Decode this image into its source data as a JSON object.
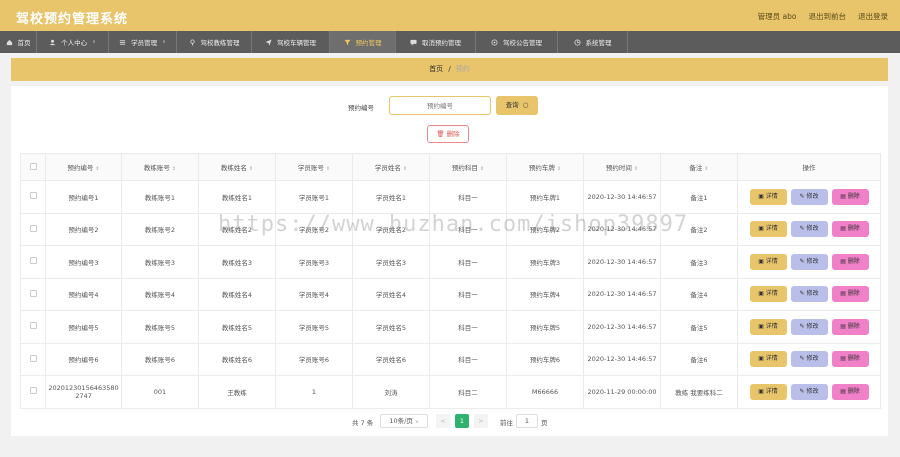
{
  "app": {
    "title": "驾校预约管理系统",
    "admin_label": "管理员 abo",
    "back_label": "退出到前台",
    "logout_label": "退出登录"
  },
  "nav": [
    {
      "label": "首页",
      "icon": "home-icon",
      "caret": false
    },
    {
      "label": "个人中心",
      "icon": "user-icon",
      "caret": true
    },
    {
      "label": "学员管理",
      "icon": "list-icon",
      "caret": true
    },
    {
      "label": "驾校教练管理",
      "icon": "pin-icon",
      "caret": false
    },
    {
      "label": "驾校车辆管理",
      "icon": "send-icon",
      "caret": false
    },
    {
      "label": "预约管理",
      "icon": "filter-icon",
      "caret": false
    },
    {
      "label": "取消预约管理",
      "icon": "chat-icon",
      "caret": false
    },
    {
      "label": "驾校公告管理",
      "icon": "gear-icon",
      "caret": false
    },
    {
      "label": "系统管理",
      "icon": "cog-icon",
      "caret": false
    }
  ],
  "breadcrumb": {
    "home": "首页",
    "separator": "/",
    "current": "预约"
  },
  "search": {
    "label": "预约编号",
    "placeholder": "预约编号",
    "button": "查询"
  },
  "delete_button": "删除",
  "table": {
    "columns": [
      "预约编号",
      "教练账号",
      "教练姓名",
      "学员账号",
      "学员姓名",
      "预约科目",
      "预约车牌",
      "预约时间",
      "备注",
      "操作"
    ],
    "actions": {
      "detail": "详情",
      "edit": "修改",
      "delete": "删除"
    },
    "rows": [
      [
        "预约编号1",
        "教练账号1",
        "教练姓名1",
        "学员账号1",
        "学员姓名1",
        "科目一",
        "预约车牌1",
        "2020-12-30 14:46:57",
        "备注1"
      ],
      [
        "预约编号2",
        "教练账号2",
        "教练姓名2",
        "学员账号2",
        "学员姓名2",
        "科目一",
        "预约车牌2",
        "2020-12-30 14:46:57",
        "备注2"
      ],
      [
        "预约编号3",
        "教练账号3",
        "教练姓名3",
        "学员账号3",
        "学员姓名3",
        "科目一",
        "预约车牌3",
        "2020-12-30 14:46:57",
        "备注3"
      ],
      [
        "预约编号4",
        "教练账号4",
        "教练姓名4",
        "学员账号4",
        "学员姓名4",
        "科目一",
        "预约车牌4",
        "2020-12-30 14:46:57",
        "备注4"
      ],
      [
        "预约编号5",
        "教练账号5",
        "教练姓名5",
        "学员账号5",
        "学员姓名5",
        "科目一",
        "预约车牌5",
        "2020-12-30 14:46:57",
        "备注5"
      ],
      [
        "预约编号6",
        "教练账号6",
        "教练姓名6",
        "学员账号6",
        "学员姓名6",
        "科目一",
        "预约车牌6",
        "2020-12-30 14:46:57",
        "备注6"
      ],
      [
        "20201230156463580 2747",
        "001",
        "王教练",
        "1",
        "刘涛",
        "科目二",
        "M66666",
        "2020-11-29 00:00:00",
        "教练 我要练科二"
      ]
    ]
  },
  "pagination": {
    "total": "共 7 条",
    "page_size": "10条/页",
    "prev": "<",
    "current_page": "1",
    "next": ">",
    "goto_label": "前往",
    "goto_value": "1",
    "page_suffix": "页"
  },
  "watermark": "https://www.huzhan.com/ishop39897",
  "colors": {
    "primary": "#e8c46a",
    "nav": "#5c5c5c",
    "edit": "#b9bfe8",
    "delete": "#f080c8",
    "page_active": "#2fb170"
  }
}
